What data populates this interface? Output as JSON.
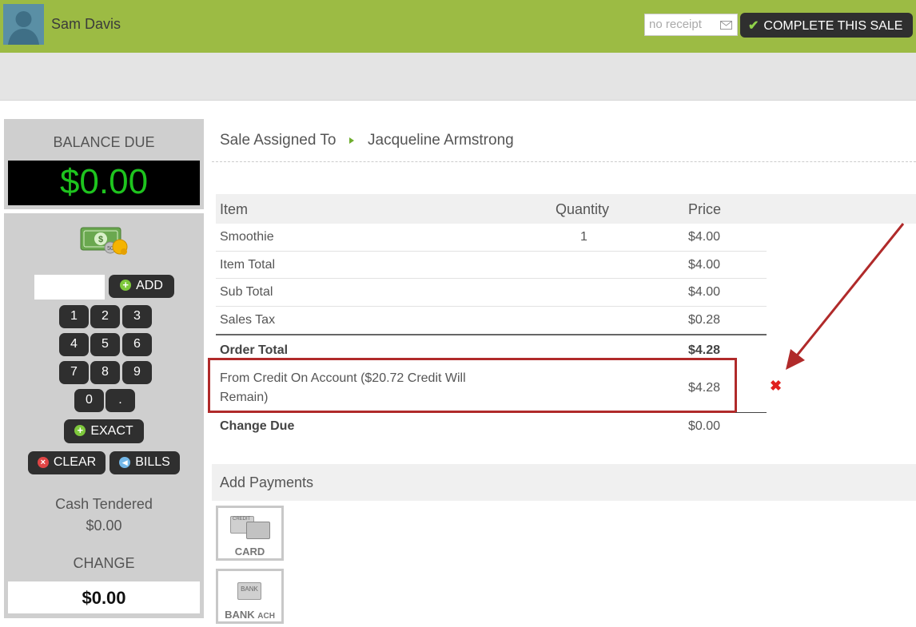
{
  "header": {
    "user_name": "Sam Davis",
    "receipt_placeholder": "no receipt",
    "complete_label": "COMPLETE THIS SALE",
    "bg_color": "#9cbb44"
  },
  "register": {
    "balance_label": "BALANCE DUE",
    "balance_value": "$0.00",
    "add_label": "ADD",
    "keys": [
      "1",
      "2",
      "3",
      "4",
      "5",
      "6",
      "7",
      "8",
      "9",
      "0",
      "."
    ],
    "exact_label": "EXACT",
    "clear_label": "CLEAR",
    "bills_label": "BILLS",
    "cash_icon_text": "50",
    "cash_tendered_label": "Cash Tendered",
    "cash_tendered_value": "$0.00",
    "change_label": "CHANGE",
    "change_value": "$0.00"
  },
  "sale": {
    "assigned_label": "Sale Assigned To",
    "assigned_name": "Jacqueline Armstrong",
    "columns": {
      "item": "Item",
      "quantity": "Quantity",
      "price": "Price"
    },
    "items": [
      {
        "name": "Smoothie",
        "quantity": "1",
        "price": "$4.00"
      }
    ],
    "totals": [
      {
        "label": "Item Total",
        "value": "$4.00"
      },
      {
        "label": "Sub Total",
        "value": "$4.00"
      },
      {
        "label": "Sales Tax",
        "value": "$0.28"
      }
    ],
    "order_total_label": "Order Total",
    "order_total_value": "$4.28",
    "credit_line_1": "From Credit On Account ($20.72 Credit Will",
    "credit_line_2": "Remain)",
    "credit_value": "$4.28",
    "change_due_label": "Change Due",
    "change_due_value": "$0.00"
  },
  "payments": {
    "title": "Add Payments",
    "card_label": "CARD",
    "card_icon_text": "CREDIT",
    "bank_label": "BANK",
    "bank_suffix": "ACH",
    "bank_icon_text": "BANK"
  }
}
